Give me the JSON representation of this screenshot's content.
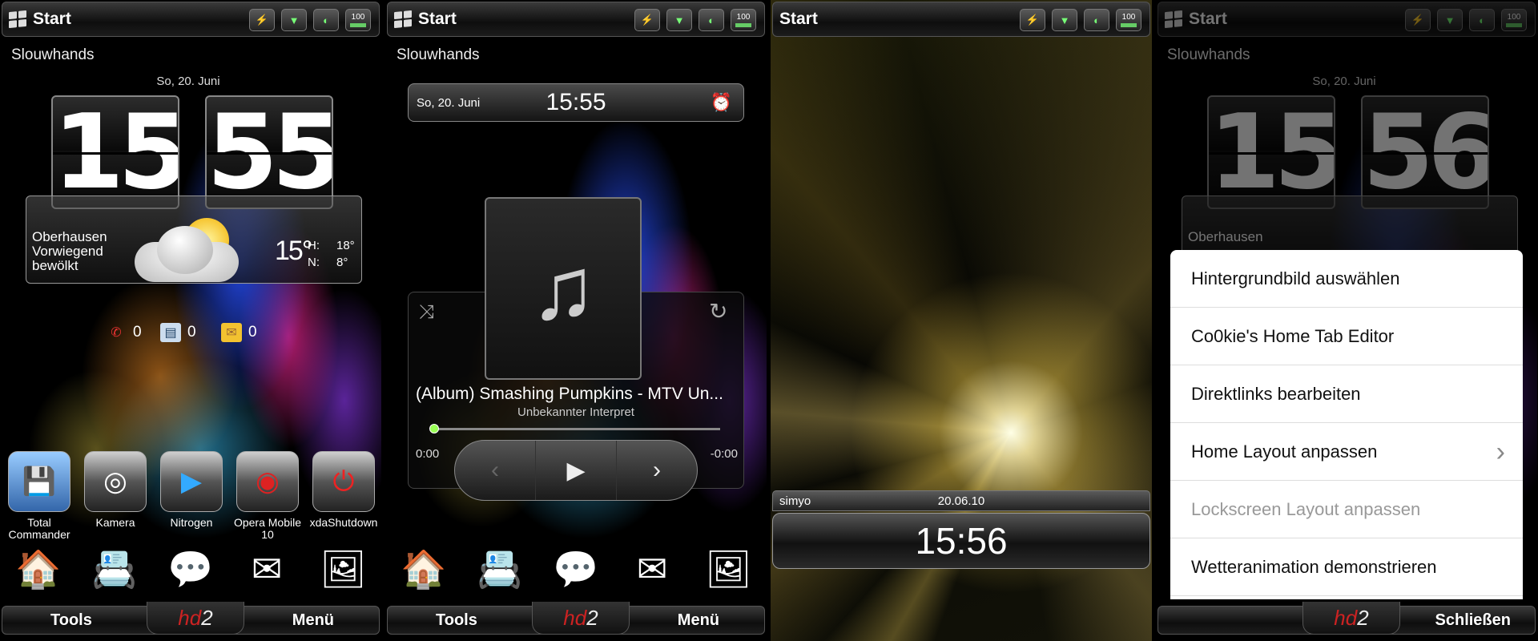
{
  "status_bar": {
    "start_label": "Start",
    "battery": "100",
    "icons": [
      "usb-icon",
      "signal-icon",
      "sync-icon",
      "battery-icon"
    ]
  },
  "home": {
    "owner": "Slouwhands",
    "date": "So, 20. Juni",
    "hours": "15",
    "minutes": "55",
    "weather": {
      "city": "Oberhausen",
      "condition_line1": "Vorwiegend",
      "condition_line2": "bewölkt",
      "temp": "15°",
      "high_label": "H:",
      "high": "18°",
      "low_label": "N:",
      "low": "8°"
    },
    "notifications": {
      "missed_calls": "0",
      "sms": "0",
      "email": "0"
    },
    "apps": [
      {
        "label": "Total Commander",
        "icon": "total-commander-icon"
      },
      {
        "label": "Kamera",
        "icon": "camera-icon"
      },
      {
        "label": "Nitrogen",
        "icon": "nitrogen-icon"
      },
      {
        "label": "Opera Mobile 10",
        "icon": "opera-icon"
      },
      {
        "label": "xdaShutdown",
        "icon": "shutdown-icon"
      }
    ]
  },
  "bottom_bar": {
    "left": "Tools",
    "right": "Menü",
    "logo_hd": "hd",
    "logo_2": "2"
  },
  "music": {
    "date": "So, 20. Juni",
    "time": "15:55",
    "song": "(Album) Smashing Pumpkins - MTV Un...",
    "artist": "Unbekannter Interpret",
    "elapsed": "0:00",
    "remaining": "-0:00",
    "progress": 0
  },
  "lock": {
    "start_label": "Start",
    "operator": "simyo",
    "date": "20.06.10",
    "time": "15:56"
  },
  "menu_panel": {
    "minutes": "56",
    "close_label": "Schließen",
    "items": [
      {
        "label": "Hintergrundbild auswählen",
        "enabled": true,
        "submenu": false
      },
      {
        "label": "Co0kie's Home Tab Editor",
        "enabled": true,
        "submenu": false
      },
      {
        "label": "Direktlinks bearbeiten",
        "enabled": true,
        "submenu": false
      },
      {
        "label": "Home Layout anpassen",
        "enabled": true,
        "submenu": true
      },
      {
        "label": "Lockscreen Layout anpassen",
        "enabled": false,
        "submenu": false
      },
      {
        "label": "Wetteranimation demonstrieren",
        "enabled": true,
        "submenu": false
      }
    ]
  },
  "colors": {
    "accent_red": "#cc2222",
    "progress_knob": "#99ff55"
  }
}
